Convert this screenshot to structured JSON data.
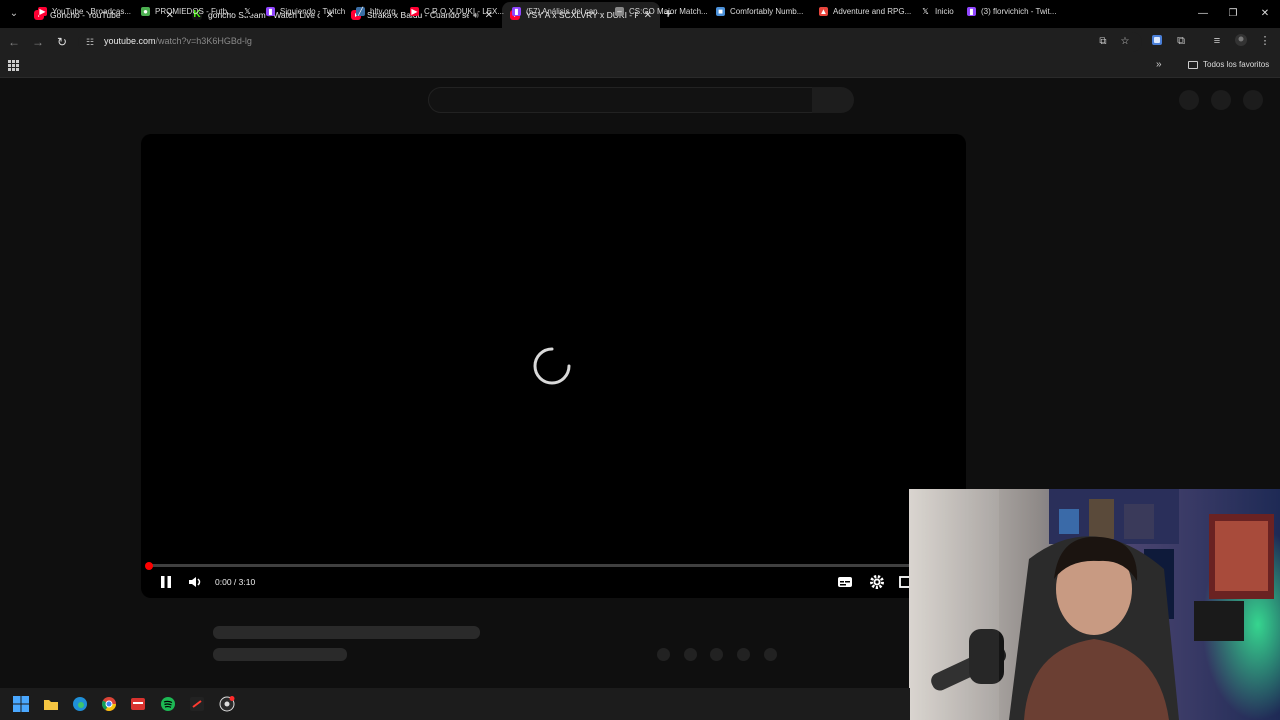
{
  "browser": {
    "tabs": [
      {
        "title": "Goncho - YouTube",
        "favicon": "youtube-icon",
        "active": false
      },
      {
        "title": "goncho Stream - Watch Live on",
        "favicon": "kick-icon",
        "active": false
      },
      {
        "title": "Straka x Baldu - Cuando se",
        "favicon": "youtube-icon",
        "active": false
      },
      {
        "title": "YSY A x SCXLVRY x DUKI - RESA",
        "favicon": "youtube-icon",
        "active": true
      }
    ],
    "new_tab_label": "+",
    "url_host": "youtube.com",
    "url_path": "/watch?v=h3K6HGBd-lg",
    "bookmarks": [
      {
        "label": "YouTube - Broadcas...",
        "icon": "youtube-icon",
        "color": "#ff0033"
      },
      {
        "label": "PROMIEDOS - Futb...",
        "icon": "promiedos-icon",
        "color": "#4caf50"
      },
      {
        "label": "",
        "icon": "x-icon",
        "color": "#000000"
      },
      {
        "label": "Siguiendo - Twitch",
        "icon": "twitch-icon",
        "color": "#9146ff"
      },
      {
        "label": "hltv.org",
        "icon": "hltv-icon",
        "color": "#3a6ea5"
      },
      {
        "label": "C.R.O X DUKI - LEX...",
        "icon": "youtube-icon",
        "color": "#ff0033"
      },
      {
        "label": "(57) Análisis del can...",
        "icon": "twitch-icon",
        "color": "#9146ff"
      },
      {
        "label": "CS:GO Major Match...",
        "icon": "link-icon",
        "color": "#888888"
      },
      {
        "label": "Comfortably Numb...",
        "icon": "bookmark-icon",
        "color": "#4a90d9"
      },
      {
        "label": "Adventure and RPG...",
        "icon": "game-icon",
        "color": "#e8453c"
      },
      {
        "label": "Inicio",
        "icon": "x-icon",
        "color": "#000000"
      },
      {
        "label": "(3) florvichich - Twit...",
        "icon": "twitch-icon",
        "color": "#9146ff"
      }
    ],
    "all_bookmarks_label": "Todos los favoritos"
  },
  "player": {
    "time_display": "0:00 / 3:10",
    "progress_fraction": 0.0,
    "state": "loading"
  },
  "colors": {
    "accent": "#ff0000",
    "page_bg": "#0f0f0f"
  }
}
